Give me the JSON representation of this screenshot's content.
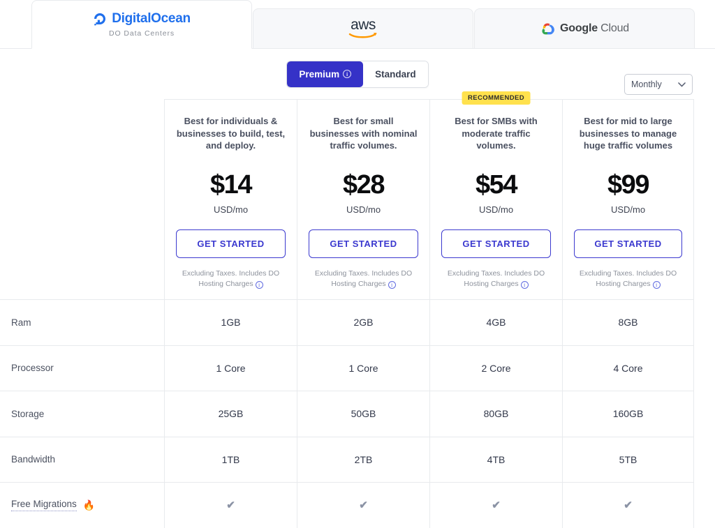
{
  "tabs": [
    {
      "id": "digitalocean",
      "name": "DigitalOcean",
      "sublabel": "DO Data Centers",
      "active": true
    },
    {
      "id": "aws",
      "name": "aws",
      "sublabel": "",
      "active": false
    },
    {
      "id": "google-cloud",
      "name": "Google Cloud",
      "name_bold": "Google",
      "name_light": "Cloud",
      "sublabel": "",
      "active": false
    }
  ],
  "controls": {
    "segmented": {
      "premium_label": "Premium",
      "premium_info_glyph": "i",
      "standard_label": "Standard",
      "selected": "Premium"
    },
    "period": {
      "value": "Monthly",
      "chevron": "⌄"
    }
  },
  "colors": {
    "accent": "#3532c7",
    "cta_border": "#3b39cf",
    "badge_bg": "#ffe14d",
    "do_blue": "#1f6fec",
    "border": "#e8eaed"
  },
  "plans": [
    {
      "badge": "",
      "description": "Best for individuals & businesses to build, test, and deploy.",
      "price": "$14",
      "unit": "USD/mo",
      "cta": "GET STARTED",
      "note": "Excluding Taxes. Includes DO Hosting Charges"
    },
    {
      "badge": "",
      "description": "Best for small businesses with nominal traffic volumes.",
      "price": "$28",
      "unit": "USD/mo",
      "cta": "GET STARTED",
      "note": "Excluding Taxes. Includes DO Hosting Charges"
    },
    {
      "badge": "RECOMMENDED",
      "description": "Best for SMBs with moderate traffic volumes.",
      "price": "$54",
      "unit": "USD/mo",
      "cta": "GET STARTED",
      "note": "Excluding Taxes. Includes DO Hosting Charges"
    },
    {
      "badge": "",
      "description": "Best for mid to large businesses to manage huge traffic volumes",
      "price": "$99",
      "unit": "USD/mo",
      "cta": "GET STARTED",
      "note": "Excluding Taxes. Includes DO Hosting Charges"
    }
  ],
  "features": [
    {
      "label": "Ram",
      "emoji": "",
      "dotted": false,
      "values": [
        "1GB",
        "2GB",
        "4GB",
        "8GB"
      ]
    },
    {
      "label": "Processor",
      "emoji": "",
      "dotted": false,
      "values": [
        "1 Core",
        "1 Core",
        "2 Core",
        "4 Core"
      ]
    },
    {
      "label": "Storage",
      "emoji": "",
      "dotted": false,
      "values": [
        "25GB",
        "50GB",
        "80GB",
        "160GB"
      ]
    },
    {
      "label": "Bandwidth",
      "emoji": "",
      "dotted": false,
      "values": [
        "1TB",
        "2TB",
        "4TB",
        "5TB"
      ]
    },
    {
      "label": "Free Migrations",
      "emoji": "🔥",
      "dotted": true,
      "values": [
        "✔",
        "✔",
        "✔",
        "✔"
      ]
    }
  ]
}
